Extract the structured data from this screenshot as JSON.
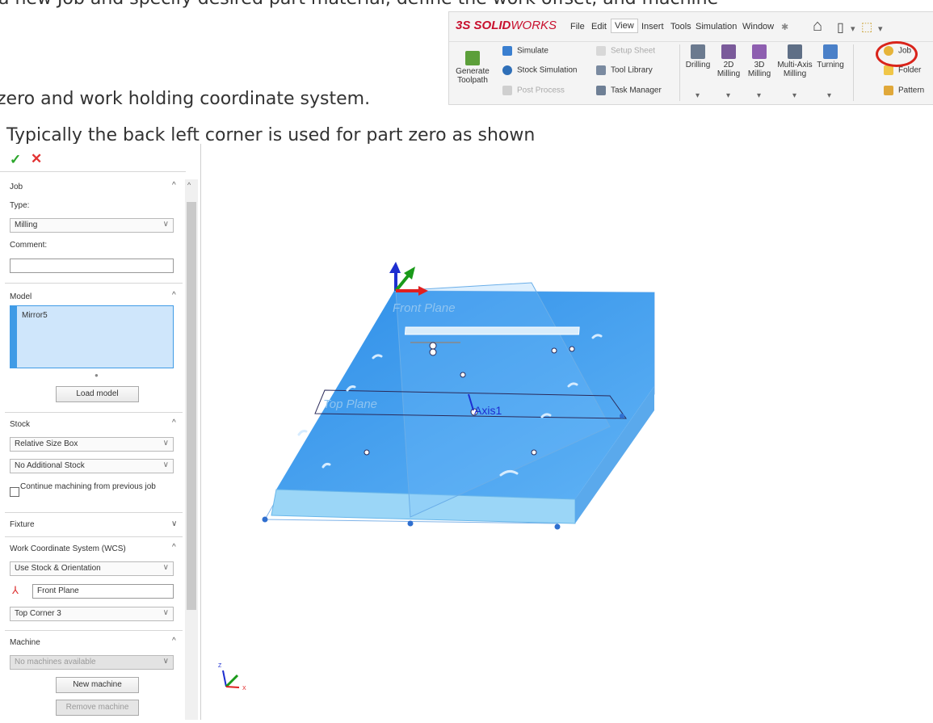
{
  "doc": {
    "line1": "a new Job and specify desired part material, define the work offset, and machine",
    "line2": "zero and work holding coordinate system.",
    "line3": "Typically the back left corner is used for part zero as shown"
  },
  "ribbon": {
    "logo_ds": "3S",
    "logo_solid": "SOLID",
    "logo_works": "WORKS",
    "menu": [
      "File",
      "Edit",
      "View",
      "Insert",
      "Tools",
      "Simulation",
      "Window"
    ],
    "pin_icon": "pin-icon",
    "quick_icons": [
      "home-icon",
      "new-document-icon",
      "open-folder-icon"
    ],
    "generate_toolpath": "Generate\nToolpath",
    "col1": [
      {
        "label": "Simulate",
        "icon": "simulate-icon",
        "enabled": true
      },
      {
        "label": "Stock Simulation",
        "icon": "stock-simulation-icon",
        "enabled": true
      },
      {
        "label": "Post Process",
        "icon": "post-process-icon",
        "enabled": false
      }
    ],
    "col2": [
      {
        "label": "Setup Sheet",
        "icon": "setup-sheet-icon",
        "enabled": false
      },
      {
        "label": "Tool Library",
        "icon": "tool-library-icon",
        "enabled": true
      },
      {
        "label": "Task Manager",
        "icon": "task-manager-icon",
        "enabled": true
      }
    ],
    "operations": [
      {
        "label": "Drilling",
        "icon": "drilling-icon"
      },
      {
        "label": "2D\nMilling",
        "icon": "2d-milling-icon"
      },
      {
        "label": "3D\nMilling",
        "icon": "3d-milling-icon"
      },
      {
        "label": "Multi-Axis\nMilling",
        "icon": "multi-axis-milling-icon"
      },
      {
        "label": "Turning",
        "icon": "turning-icon"
      }
    ],
    "right_col": [
      {
        "label": "Job",
        "icon": "job-icon"
      },
      {
        "label": "Folder",
        "icon": "folder-icon"
      },
      {
        "label": "Pattern",
        "icon": "pattern-icon"
      }
    ],
    "colors": {
      "logo_red": "#c8102e",
      "highlight_circle": "#d9241b"
    }
  },
  "panel": {
    "job": {
      "title": "Job",
      "type_label": "Type:",
      "type_value": "Milling",
      "comment_label": "Comment:",
      "comment_value": ""
    },
    "model": {
      "title": "Model",
      "items": [
        "Mirror5"
      ],
      "load_button": "Load model"
    },
    "stock": {
      "title": "Stock",
      "mode": "Relative Size Box",
      "additional": "No Additional Stock",
      "continue_label": "Continue machining from previous job",
      "continue_checked": false
    },
    "fixture": {
      "title": "Fixture"
    },
    "wcs": {
      "title": "Work Coordinate System (WCS)",
      "mode": "Use Stock & Orientation",
      "plane": "Front Plane",
      "corner": "Top Corner 3"
    },
    "machine": {
      "title": "Machine",
      "selection": "No machines available",
      "new_button": "New machine",
      "remove_button": "Remove machine"
    }
  },
  "viewport": {
    "plane_labels": [
      "Front Plane",
      "Top Plane"
    ],
    "axis_label": "Axis1",
    "triad_labels": [
      "Z",
      "X"
    ],
    "colors": {
      "part_blue": "#3d9bf0",
      "part_side": "#8ccff5",
      "triad_y": "#1a9a1a",
      "triad_x": "#e02020",
      "triad_z": "#1d2ed0"
    }
  }
}
